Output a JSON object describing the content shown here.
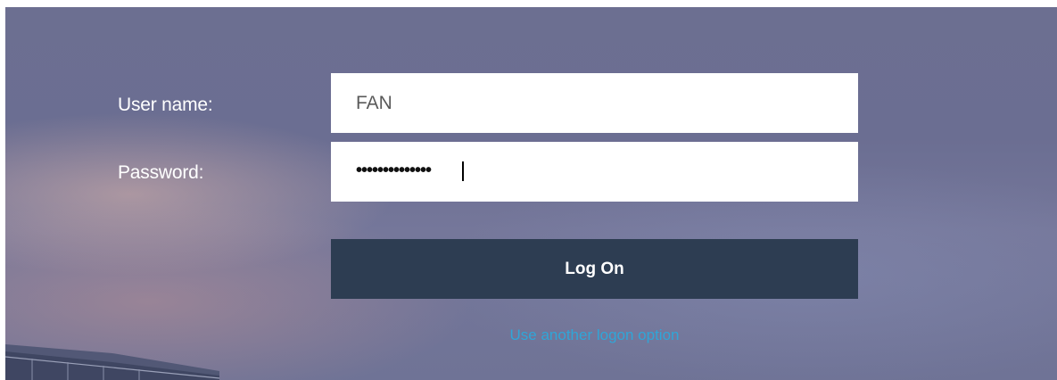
{
  "login": {
    "username_label": "User name:",
    "username_value": "FAN",
    "password_label": "Password:",
    "password_masked": "••••••••••••••",
    "logon_button": "Log On",
    "alternate_link": "Use another logon option"
  },
  "colors": {
    "button_bg": "#2d3d52",
    "link": "#2fa6d8",
    "label_text": "#ffffff"
  }
}
